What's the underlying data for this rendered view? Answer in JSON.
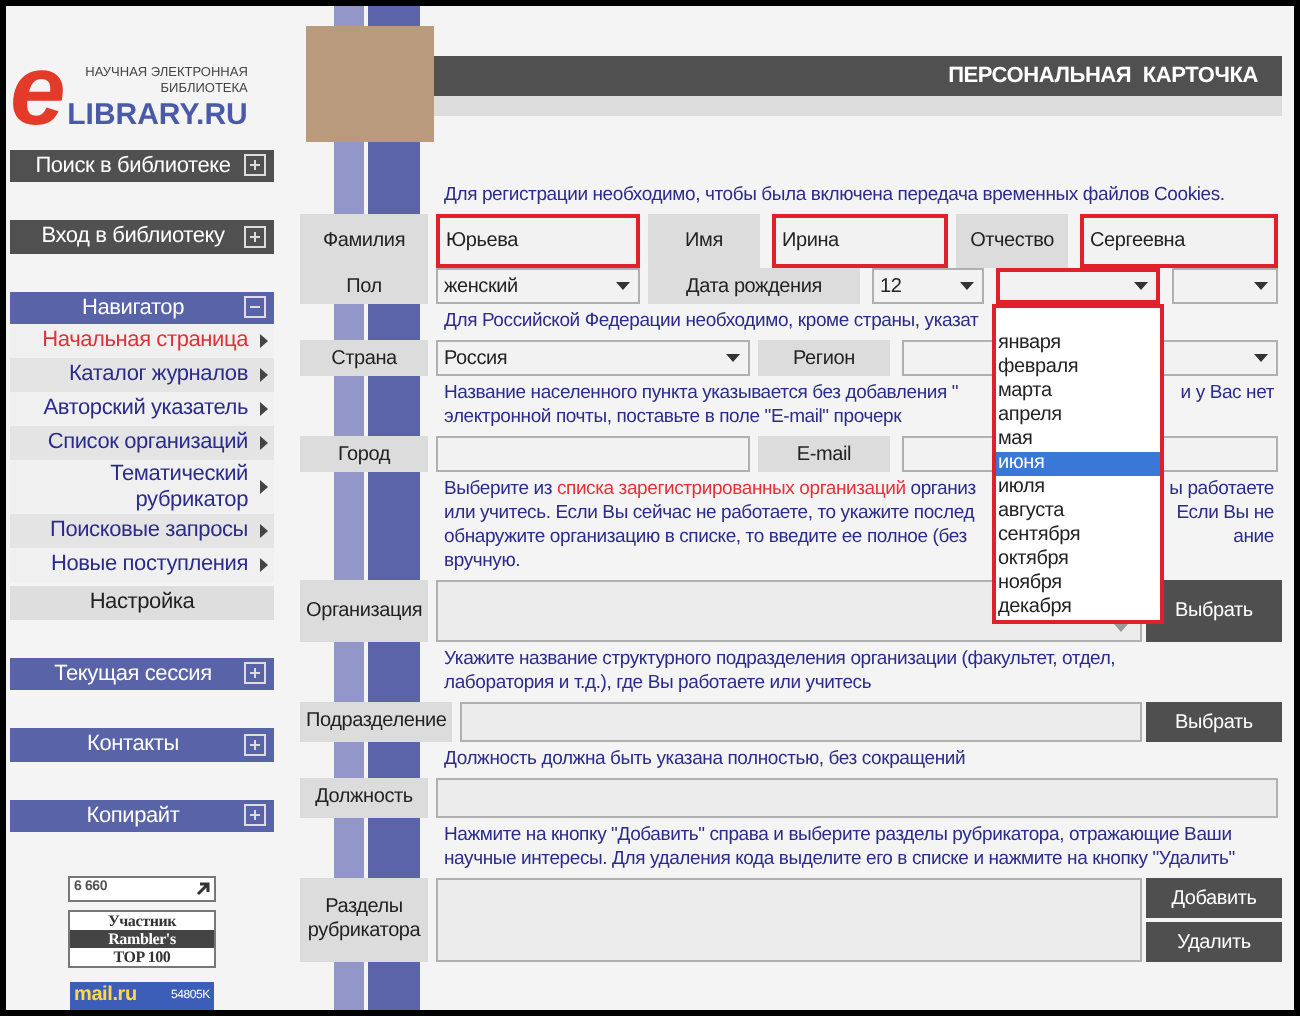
{
  "sidebar": {
    "logo": {
      "mark": "e",
      "tagline_1": "НАУЧНАЯ ЭЛЕКТРОННАЯ",
      "tagline_2": "БИБЛИОТЕКА",
      "name": "LIBRARY.RU"
    },
    "sections": [
      {
        "title": "Поиск в библиотеке",
        "kind": "dark",
        "expanded": false
      },
      {
        "title": "Вход в библиотеку",
        "kind": "dark",
        "expanded": false
      },
      {
        "title": "Навигатор",
        "kind": "blue",
        "expanded": true,
        "items": [
          {
            "text": "Начальная страница",
            "kind": "link",
            "selected": true
          },
          {
            "text": "Каталог журналов",
            "kind": "link",
            "selected": false
          },
          {
            "text": "Авторский указатель",
            "kind": "link",
            "selected": false
          },
          {
            "text": "Список организаций",
            "kind": "link",
            "selected": false
          },
          {
            "text": "Тематический рубрикатор",
            "kind": "link",
            "selected": false
          },
          {
            "text": "Поисковые запросы",
            "kind": "link",
            "selected": false
          },
          {
            "text": "Новые поступления",
            "kind": "link",
            "selected": false
          },
          {
            "text": "Настройка",
            "kind": "setting",
            "selected": false
          }
        ]
      },
      {
        "title": "Текущая сессия",
        "kind": "blue",
        "expanded": false
      },
      {
        "title": "Контакты",
        "kind": "blue",
        "expanded": false
      },
      {
        "title": "Копирайт",
        "kind": "blue",
        "expanded": false
      }
    ],
    "counters": {
      "hits": "6 660",
      "rambler": [
        "Участник",
        "Rambler's",
        "TOP 100"
      ],
      "mail": "mail.ru",
      "mail_count": "54805K"
    }
  },
  "header": {
    "title": "ПЕРСОНАЛЬНАЯ  КАРТОЧКА"
  },
  "rows": [
    {
      "kind": "note",
      "lines": [
        {
          "left": [
            {
              "text": "Для регистрации необходимо, чтобы была включена передача временных файлов Cookies.",
              "link": false
            }
          ]
        }
      ]
    },
    {
      "kind": "triple",
      "items": [
        {
          "kind": "label",
          "text": "Фамилия"
        },
        {
          "kind": "input",
          "value": "Юрьева",
          "highlighted": true
        },
        {
          "kind": "label",
          "text": "Имя"
        },
        {
          "kind": "input",
          "value": "Ирина",
          "highlighted": true
        },
        {
          "kind": "label",
          "text": "Отчество"
        },
        {
          "kind": "input",
          "value": "Сергеевна",
          "highlighted": true
        }
      ]
    },
    {
      "kind": "birth",
      "items": [
        {
          "kind": "label",
          "text": "Пол"
        },
        {
          "kind": "select",
          "value": "женский",
          "highlighted": false
        },
        {
          "kind": "label",
          "text": "Дата рождения"
        },
        {
          "kind": "select",
          "value": "12",
          "highlighted": false
        },
        {
          "kind": "select",
          "highlighted": true,
          "options": [
            {
              "text": "января",
              "selected": false
            },
            {
              "text": "февраля",
              "selected": false
            },
            {
              "text": "марта",
              "selected": false
            },
            {
              "text": "апреля",
              "selected": false
            },
            {
              "text": "мая",
              "selected": false
            },
            {
              "text": "июня",
              "selected": true
            },
            {
              "text": "июля",
              "selected": false
            },
            {
              "text": "августа",
              "selected": false
            },
            {
              "text": "сентября",
              "selected": false
            },
            {
              "text": "октября",
              "selected": false
            },
            {
              "text": "ноября",
              "selected": false
            },
            {
              "text": "декабря",
              "selected": false
            }
          ]
        },
        {
          "kind": "select",
          "highlighted": false
        }
      ]
    },
    {
      "kind": "note",
      "lines": [
        {
          "left": [
            {
              "text": "Для Российской Федерации необходимо, кроме страны, указат",
              "link": false
            }
          ]
        }
      ]
    },
    {
      "kind": "pair",
      "items": [
        {
          "kind": "label",
          "text": "Страна"
        },
        {
          "kind": "select",
          "value": "Россия",
          "highlighted": false
        },
        {
          "kind": "label",
          "text": "Регион"
        },
        {
          "kind": "select",
          "highlighted": false
        }
      ]
    },
    {
      "kind": "note",
      "lines": [
        {
          "left": [
            {
              "text": "Название населенного пункта указывается без добавления \"",
              "link": false
            }
          ],
          "right": "и у Вас нет"
        },
        {
          "left": [
            {
              "text": "электронной почты, поставьте в поле \"E-mail\" прочерк",
              "link": false
            }
          ]
        }
      ]
    },
    {
      "kind": "pair",
      "items": [
        {
          "kind": "label",
          "text": "Город"
        },
        {
          "kind": "input",
          "highlighted": false
        },
        {
          "kind": "label",
          "text": "E-mail"
        },
        {
          "kind": "input",
          "highlighted": false
        }
      ]
    },
    {
      "kind": "note",
      "lines": [
        {
          "left": [
            {
              "text": "Выберите из ",
              "link": false
            },
            {
              "text": "списка зарегистрированных организаций",
              "link": true
            },
            {
              "text": " организ",
              "link": false
            }
          ],
          "right": "ы работаете"
        },
        {
          "left": [
            {
              "text": "или учитесь. Если Вы сейчас не работаете, то укажите послед",
              "link": false
            }
          ],
          "right": "Если Вы не"
        },
        {
          "left": [
            {
              "text": "обнаружите организацию в списке, то введите ее полное (без",
              "link": false
            }
          ],
          "right": "ание"
        },
        {
          "left": [
            {
              "text": "вручную.",
              "link": false
            }
          ]
        }
      ]
    },
    {
      "kind": "combo_row",
      "label": "Организация",
      "buttons": [
        "Выбрать"
      ]
    },
    {
      "kind": "note",
      "lines": [
        {
          "left": [
            {
              "text": "Укажите название структурного подразделения организации (факультет, отдел,",
              "link": false
            }
          ]
        },
        {
          "left": [
            {
              "text": "лаборатория и т.д.), где Вы работаете или учитесь",
              "link": false
            }
          ]
        }
      ]
    },
    {
      "kind": "input_row",
      "label": "Подразделение",
      "buttons": [
        "Выбрать"
      ]
    },
    {
      "kind": "note",
      "lines": [
        {
          "left": [
            {
              "text": "Должность должна быть указана полностью, без сокращений",
              "link": false
            }
          ]
        }
      ]
    },
    {
      "kind": "input_row",
      "label": "Должность"
    },
    {
      "kind": "note",
      "lines": [
        {
          "left": [
            {
              "text": "Нажмите на кнопку \"Добавить\" справа и выберите разделы рубрикатора, отражающие Ваши",
              "link": false
            }
          ]
        },
        {
          "left": [
            {
              "text": "научные интересы. Для удаления кода выделите его в списке и нажмите на кнопку \"Удалить\"",
              "link": false
            }
          ]
        }
      ]
    },
    {
      "kind": "area",
      "label": "Разделы рубрикатора",
      "buttons": [
        "Добавить",
        "Удалить"
      ]
    }
  ]
}
